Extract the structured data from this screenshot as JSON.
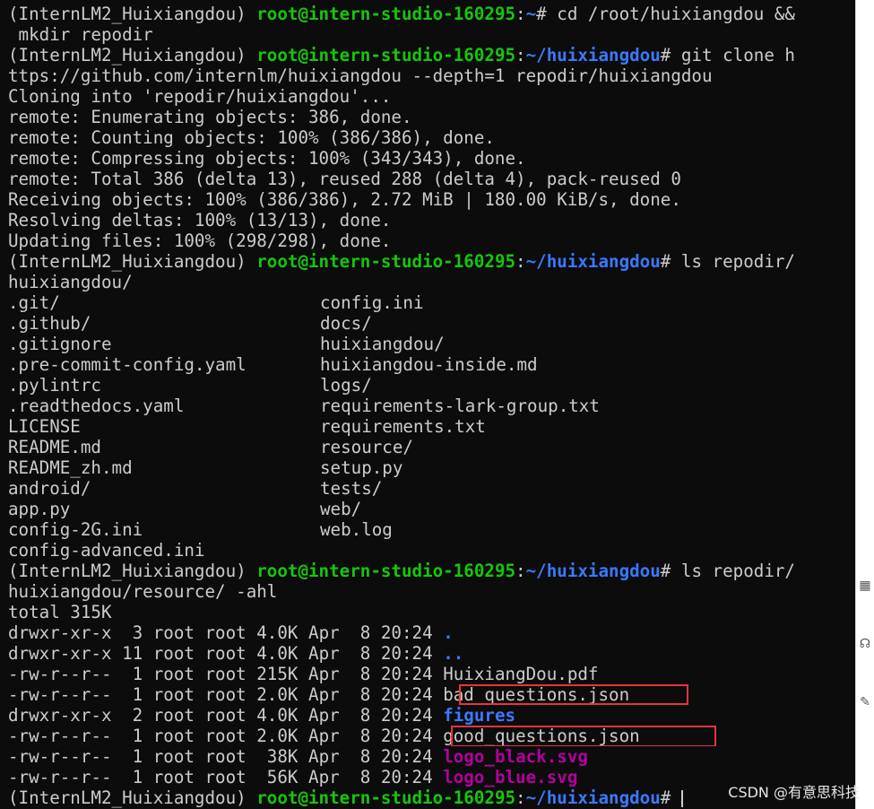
{
  "prompt": {
    "env": "(InternLM2_Huixiangdou) ",
    "user_host": "root@intern-studio-160295",
    "sep": ":",
    "home_path": "~",
    "repo_path": "~/huixiangdou",
    "symbol": "# "
  },
  "lines": {
    "cmd1_a": "cd /root/huixiangdou &&",
    "cmd1_b": " mkdir repodir",
    "cmd2_a": "git clone h",
    "cmd2_b": "ttps://github.com/internlm/huixiangdou --depth=1 repodir/huixiangdou",
    "clone_1": "Cloning into 'repodir/huixiangdou'...",
    "clone_2": "remote: Enumerating objects: 386, done.",
    "clone_3": "remote: Counting objects: 100% (386/386), done.",
    "clone_4": "remote: Compressing objects: 100% (343/343), done.",
    "clone_5": "remote: Total 386 (delta 13), reused 288 (delta 4), pack-reused 0",
    "clone_6": "Receiving objects: 100% (386/386), 2.72 MiB | 180.00 KiB/s, done.",
    "clone_7": "Resolving deltas: 100% (13/13), done.",
    "clone_8": "Updating files: 100% (298/298), done.",
    "cmd3_a": "ls repodir/",
    "cmd3_b": "huixiangdou/",
    "cmd4_a": "ls repodir/",
    "cmd4_b": "huixiangdou/resource/ -ahl",
    "total": "total 315K"
  },
  "ls_left": [
    ".git/",
    ".github/",
    ".gitignore",
    ".pre-commit-config.yaml",
    ".pylintrc",
    ".readthedocs.yaml",
    "LICENSE",
    "README.md",
    "README_zh.md",
    "android/",
    "app.py",
    "config-2G.ini",
    "config-advanced.ini"
  ],
  "ls_right": [
    "config.ini",
    "docs/",
    "huixiangdou/",
    "huixiangdou-inside.md",
    "logs/",
    "requirements-lark-group.txt",
    "requirements.txt",
    "resource/",
    "setup.py",
    "tests/",
    "web/",
    "web.log"
  ],
  "ls_long": [
    {
      "perm": "drwxr-xr-x",
      "meta": "  3 root root 4.0K Apr  8 20:24 ",
      "name": "."
    },
    {
      "perm": "drwxr-xr-x",
      "meta": " 11 root root 4.0K Apr  8 20:24 ",
      "name": ".."
    },
    {
      "perm": "-rw-r--r--",
      "meta": "  1 root root 215K Apr  8 20:24 ",
      "name": "HuixiangDou.pdf"
    },
    {
      "perm": "-rw-r--r--",
      "meta": "  1 root root 2.0K Apr  8 20:24 ",
      "name": "bad_questions.json"
    },
    {
      "perm": "drwxr-xr-x",
      "meta": "  2 root root 4.0K Apr  8 20:24 ",
      "name": "figures"
    },
    {
      "perm": "-rw-r--r--",
      "meta": "  1 root root 2.0K Apr  8 20:24 ",
      "name": "good_questions.json"
    },
    {
      "perm": "-rw-r--r--",
      "meta": "  1 root root  38K Apr  8 20:24 ",
      "name": "logo_black.svg"
    },
    {
      "perm": "-rw-r--r--",
      "meta": "  1 root root  56K Apr  8 20:24 ",
      "name": "logo_blue.svg"
    }
  ],
  "watermark": "CSDN @有意思科技",
  "colors": {
    "background": "#0c0c0c",
    "foreground": "#cccccc",
    "prompt_user": "#16c60c",
    "prompt_path": "#3b78ff",
    "svg_file": "#b4009e",
    "highlight_box": "#e8343d"
  },
  "icons": {
    "strip_icons": [
      "qr-icon",
      "headset-icon",
      "edit-icon"
    ]
  }
}
